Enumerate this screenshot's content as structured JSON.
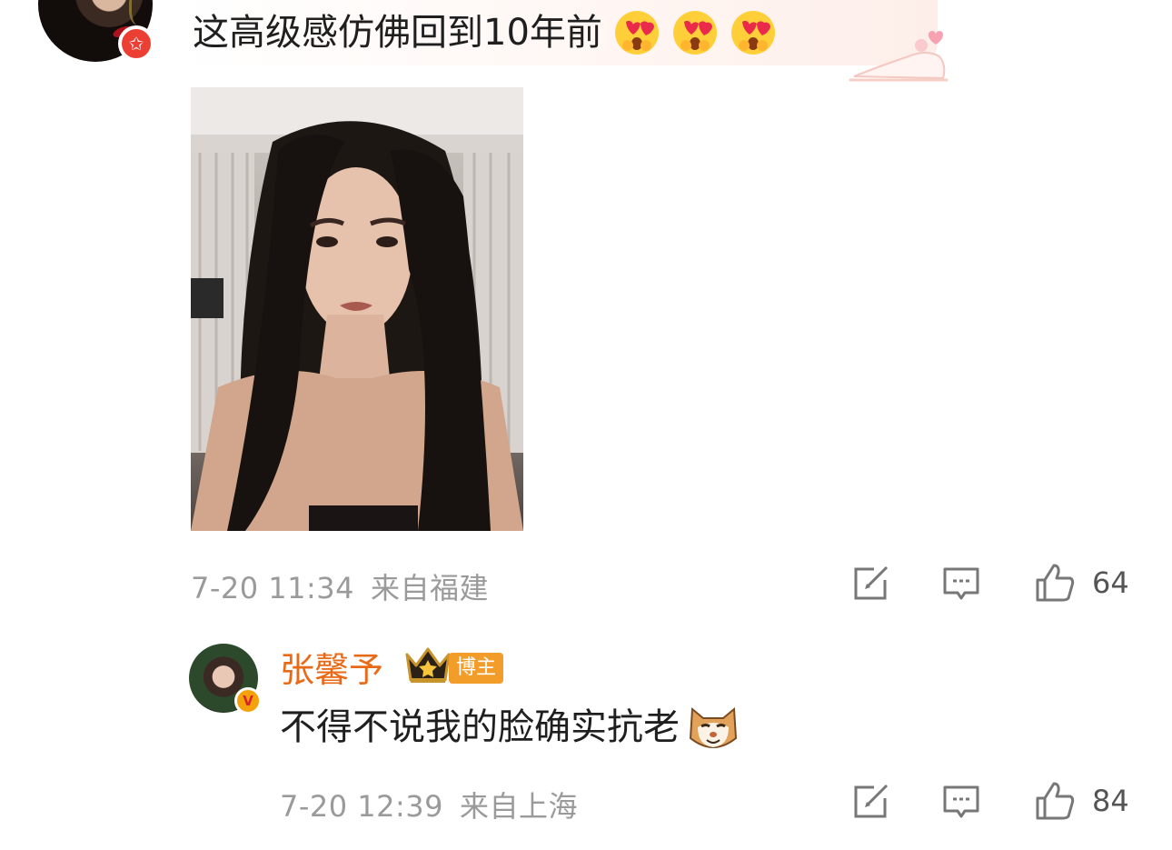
{
  "comment1": {
    "text": "这高级感仿佛回到10年前",
    "emojis": [
      "heart-eyes-emoji",
      "heart-eyes-emoji",
      "heart-eyes-emoji"
    ],
    "image": "selfie-photo",
    "time": "7-20 11:34",
    "location": "来自福建",
    "likes": "64"
  },
  "reply": {
    "username": "张馨予",
    "author_tag": "博主",
    "verified_badge": "V",
    "text": "不得不说我的脸确实抗老",
    "emoji": "cat-emoji",
    "time": "7-20 12:39",
    "location": "来自上海",
    "likes": "84"
  },
  "colors": {
    "username": "#e86a17",
    "meta": "#9a9a9a",
    "tag": "#f29d2a",
    "badge": "#ec3f34"
  }
}
